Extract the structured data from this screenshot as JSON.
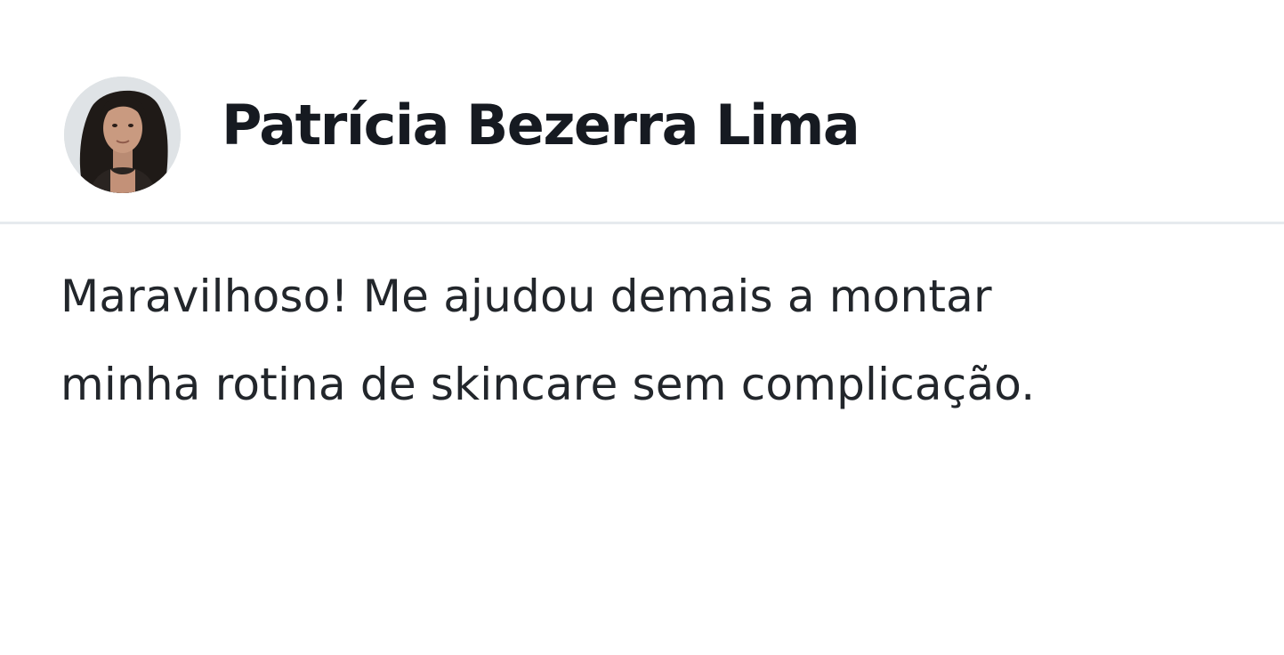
{
  "review": {
    "author_name": "Patrícia Bezerra Lima",
    "text_lines": [
      "Maravilhoso! Me ajudou demais a montar",
      "minha rotina de skincare sem complicação."
    ]
  },
  "colors": {
    "background": "#ffffff",
    "name_text": "#161a21",
    "body_text": "#22262b",
    "divider": "#e6eaee"
  },
  "icons": {
    "avatar": "user-photo-avatar"
  }
}
